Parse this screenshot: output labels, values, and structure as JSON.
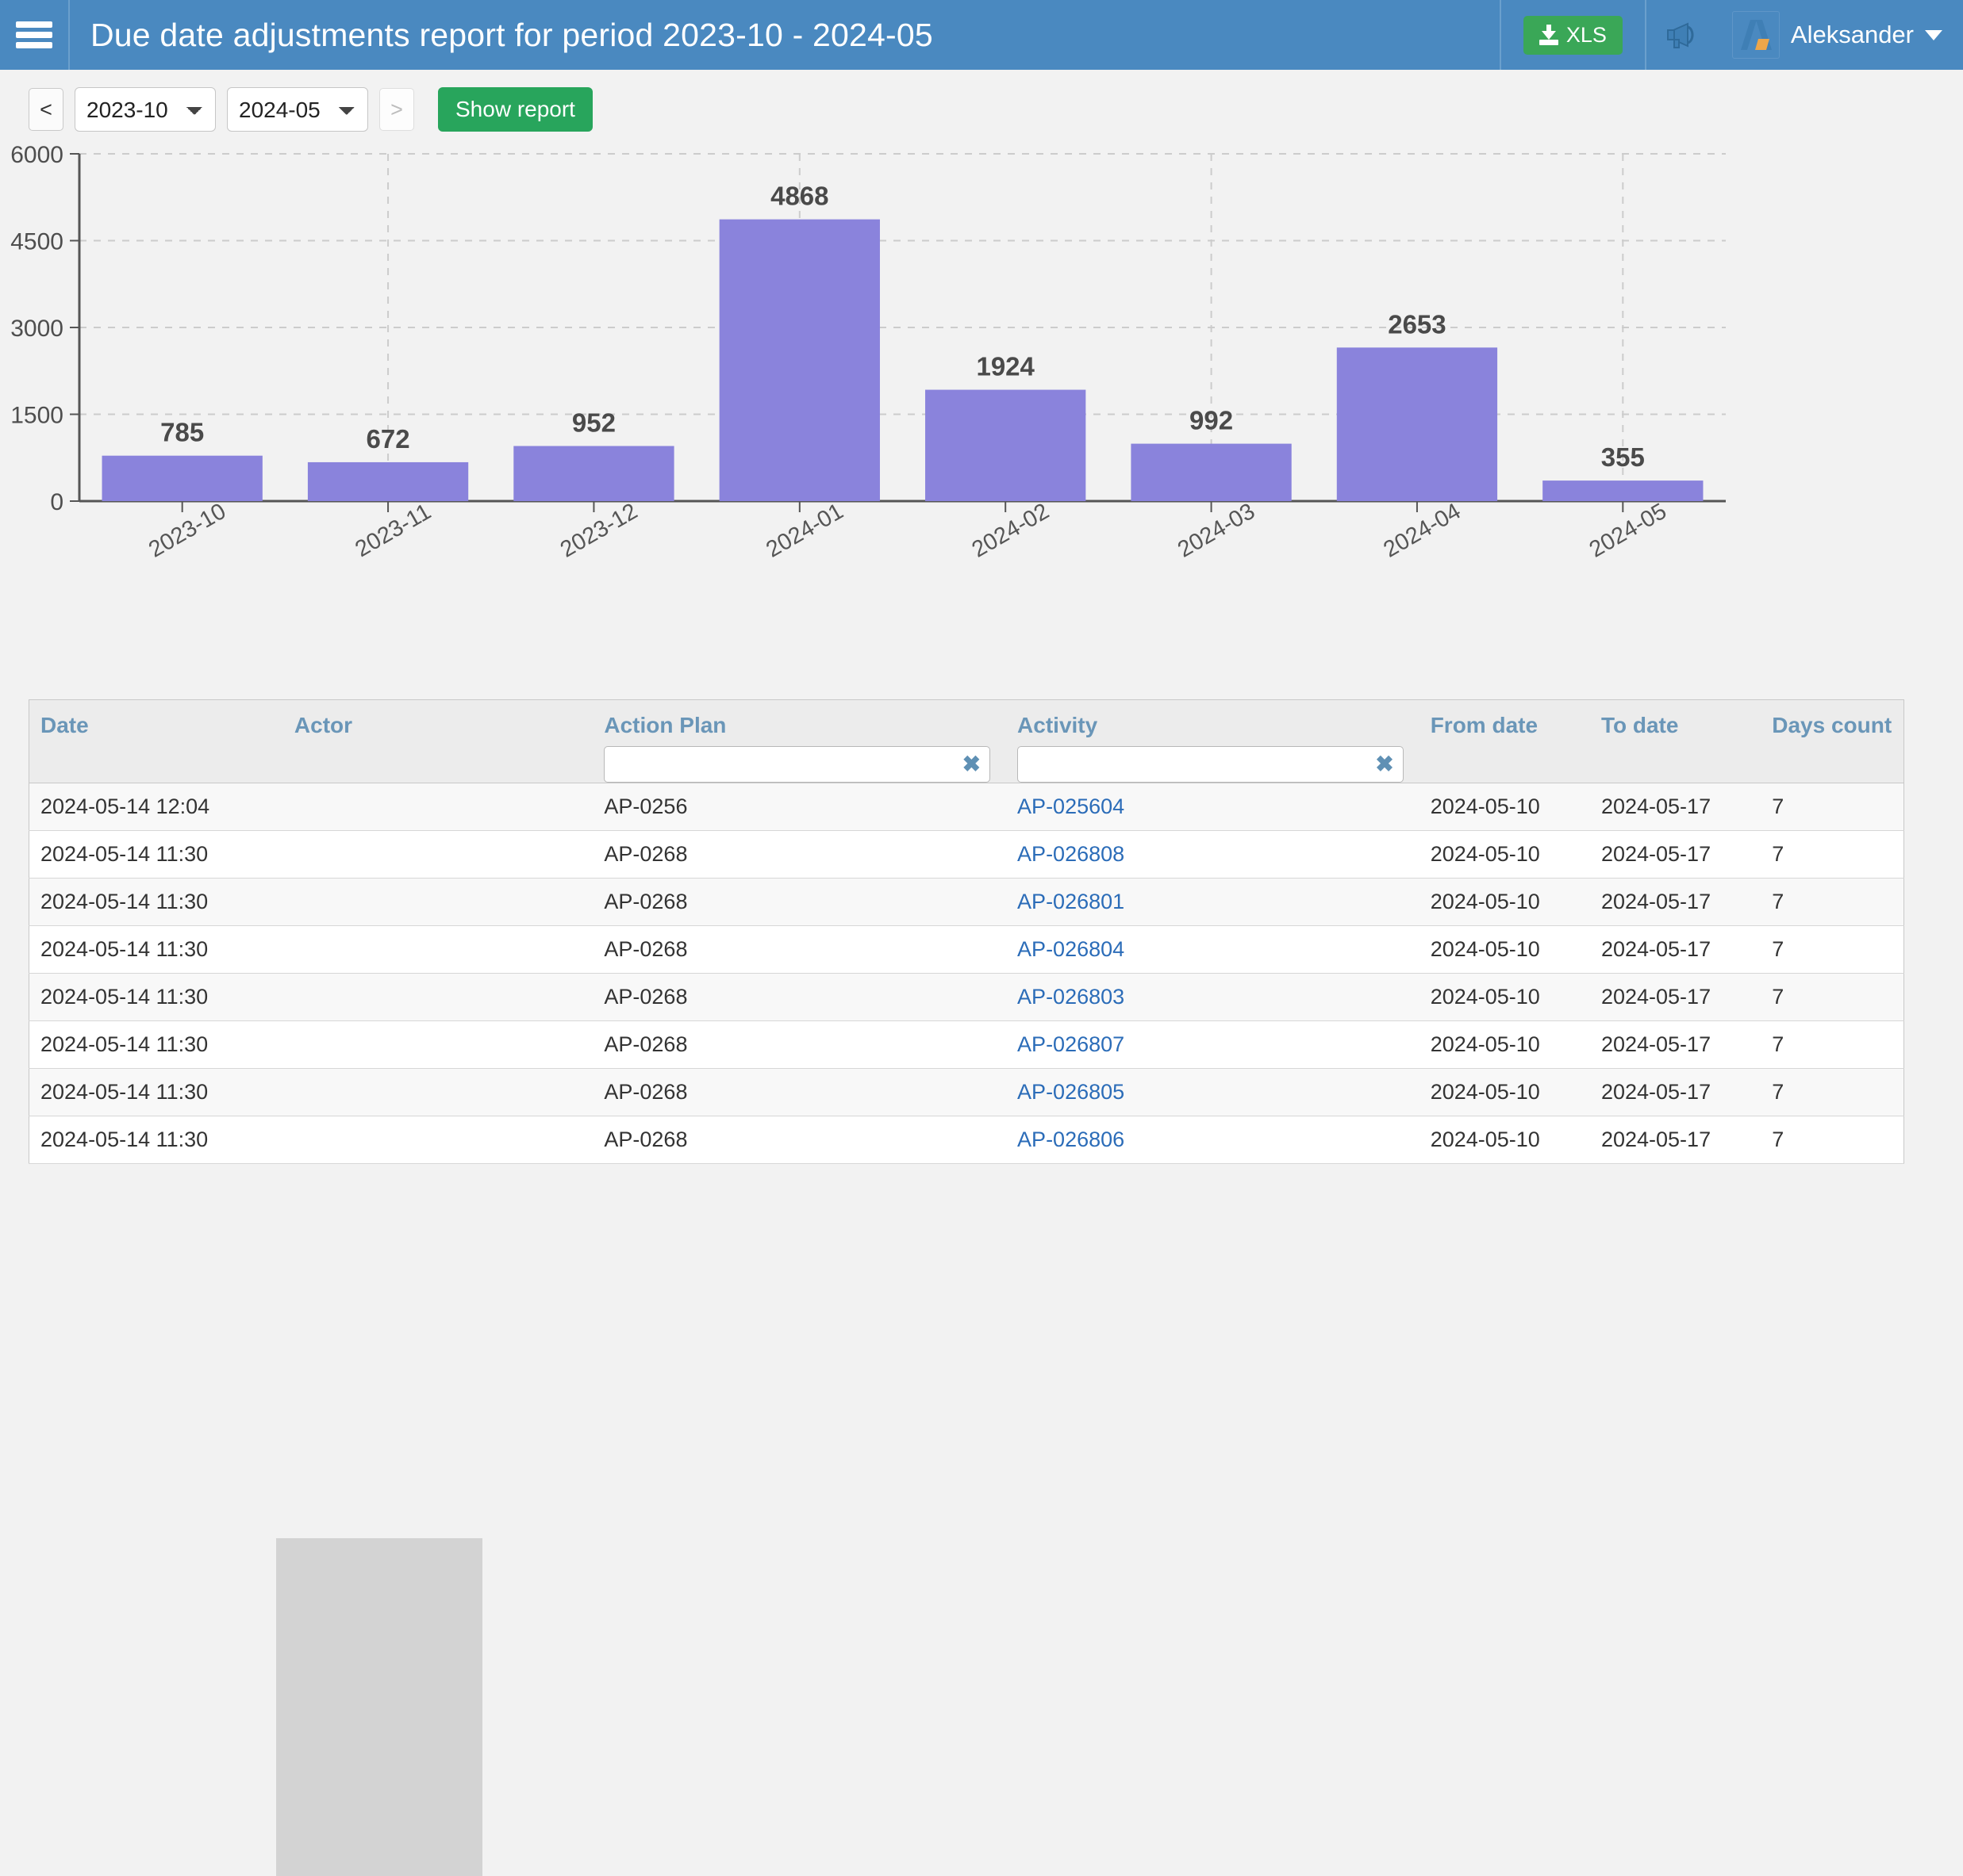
{
  "header": {
    "title": "Due date adjustments report for period 2023-10 - 2024-05",
    "menu_icon": "hamburger-icon",
    "xls_label": "XLS",
    "announcement_icon": "megaphone-icon",
    "user_name": "Aleksander",
    "brand_color": "#4a89c0",
    "xls_color": "#3aa757"
  },
  "toolbar": {
    "prev_label": "<",
    "next_label": ">",
    "from_period": "2023-10",
    "to_period": "2024-05",
    "period_options_from": [
      "2023-10"
    ],
    "period_options_to": [
      "2024-05"
    ],
    "show_report_label": "Show report",
    "show_report_color": "#28a55c"
  },
  "chart_data": {
    "type": "bar",
    "title": "",
    "xlabel": "",
    "ylabel": "",
    "categories": [
      "2023-10",
      "2023-11",
      "2023-12",
      "2024-01",
      "2024-02",
      "2024-03",
      "2024-04",
      "2024-05"
    ],
    "values": [
      785,
      672,
      952,
      4868,
      1924,
      992,
      2653,
      355
    ],
    "ylim": [
      0,
      6000
    ],
    "yticks": [
      0,
      1500,
      3000,
      4500,
      6000
    ],
    "ytick_labels": [
      "0",
      "1500",
      "3000",
      "4500",
      "6000"
    ],
    "grid": true,
    "legend": "none",
    "bar_color": "#8a83dc",
    "label_color": "#4a4a4a"
  },
  "table": {
    "columns": [
      {
        "key": "date",
        "label": "Date",
        "filter": false
      },
      {
        "key": "actor",
        "label": "Actor",
        "filter": false
      },
      {
        "key": "action_plan",
        "label": "Action Plan",
        "filter": true,
        "filter_value": "",
        "clear_label": "✖"
      },
      {
        "key": "activity",
        "label": "Activity",
        "filter": true,
        "filter_value": "",
        "clear_label": "✖"
      },
      {
        "key": "from_date",
        "label": "From date",
        "filter": false
      },
      {
        "key": "to_date",
        "label": "To date",
        "filter": false
      },
      {
        "key": "days_count",
        "label": "Days count",
        "filter": false
      }
    ],
    "rows": [
      {
        "date": "2024-05-14 12:04",
        "actor": "",
        "action_plan": "AP-0256",
        "activity": "AP-025604",
        "from_date": "2024-05-10",
        "to_date": "2024-05-17",
        "days_count": "7"
      },
      {
        "date": "2024-05-14 11:30",
        "actor": "",
        "action_plan": "AP-0268",
        "activity": "AP-026808",
        "from_date": "2024-05-10",
        "to_date": "2024-05-17",
        "days_count": "7"
      },
      {
        "date": "2024-05-14 11:30",
        "actor": "",
        "action_plan": "AP-0268",
        "activity": "AP-026801",
        "from_date": "2024-05-10",
        "to_date": "2024-05-17",
        "days_count": "7"
      },
      {
        "date": "2024-05-14 11:30",
        "actor": "",
        "action_plan": "AP-0268",
        "activity": "AP-026804",
        "from_date": "2024-05-10",
        "to_date": "2024-05-17",
        "days_count": "7"
      },
      {
        "date": "2024-05-14 11:30",
        "actor": "",
        "action_plan": "AP-0268",
        "activity": "AP-026803",
        "from_date": "2024-05-10",
        "to_date": "2024-05-17",
        "days_count": "7"
      },
      {
        "date": "2024-05-14 11:30",
        "actor": "",
        "action_plan": "AP-0268",
        "activity": "AP-026807",
        "from_date": "2024-05-10",
        "to_date": "2024-05-17",
        "days_count": "7"
      },
      {
        "date": "2024-05-14 11:30",
        "actor": "",
        "action_plan": "AP-0268",
        "activity": "AP-026805",
        "from_date": "2024-05-10",
        "to_date": "2024-05-17",
        "days_count": "7"
      },
      {
        "date": "2024-05-14 11:30",
        "actor": "",
        "action_plan": "AP-0268",
        "activity": "AP-026806",
        "from_date": "2024-05-10",
        "to_date": "2024-05-17",
        "days_count": "7"
      }
    ]
  }
}
